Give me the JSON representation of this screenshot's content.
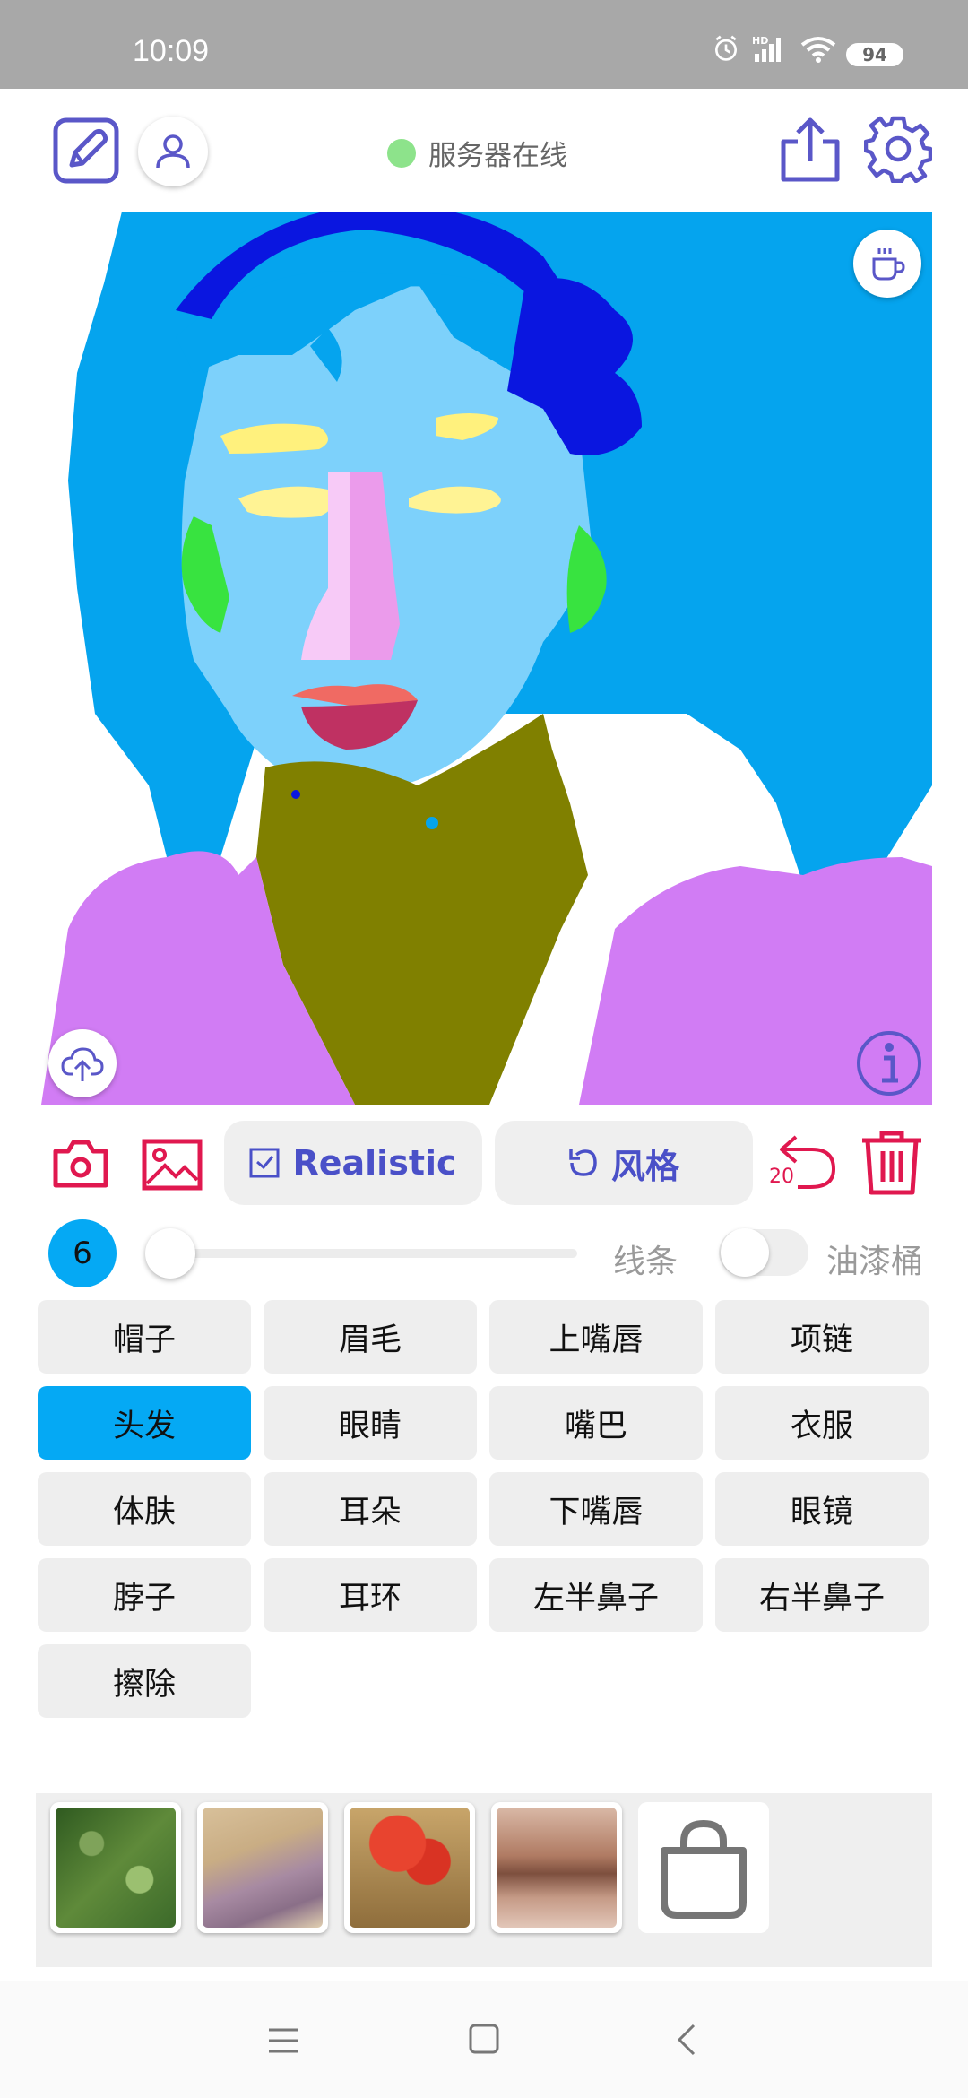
{
  "status_bar": {
    "time": "10:09",
    "battery": "94",
    "icons": [
      "alarm-icon",
      "hd-signal-icon",
      "wifi-icon",
      "battery-icon"
    ]
  },
  "top_bar": {
    "server_status": "服务器在线",
    "server_color": "#8de38b",
    "icons": [
      "edit-icon",
      "user-icon",
      "share-icon",
      "settings-icon"
    ],
    "accent": "#5a57c8"
  },
  "canvas": {
    "icons": [
      "coffee-icon",
      "cloud-upload-icon",
      "info-icon"
    ]
  },
  "toolbar": {
    "realistic_label": "Realistic",
    "style_label": "风格",
    "undo_count": "20",
    "icons": [
      "camera-icon",
      "image-icon",
      "checkbox-icon",
      "refresh-icon",
      "undo-icon",
      "trash-icon"
    ],
    "icon_color": "#e0184f"
  },
  "brush": {
    "size": "6",
    "slider_level": 0,
    "line_label": "线条",
    "bucket_label": "油漆桶",
    "bucket_enabled": false
  },
  "labels": [
    {
      "text": "帽子",
      "active": false
    },
    {
      "text": "眉毛",
      "active": false
    },
    {
      "text": "上嘴唇",
      "active": false
    },
    {
      "text": "项链",
      "active": false
    },
    {
      "text": "头发",
      "active": true
    },
    {
      "text": "眼睛",
      "active": false
    },
    {
      "text": "嘴巴",
      "active": false
    },
    {
      "text": "衣服",
      "active": false
    },
    {
      "text": "体肤",
      "active": false
    },
    {
      "text": "耳朵",
      "active": false
    },
    {
      "text": "下嘴唇",
      "active": false
    },
    {
      "text": "眼镜",
      "active": false
    },
    {
      "text": "脖子",
      "active": false
    },
    {
      "text": "耳环",
      "active": false
    },
    {
      "text": "左半鼻子",
      "active": false
    },
    {
      "text": "右半鼻子",
      "active": false
    },
    {
      "text": "擦除",
      "active": false
    }
  ],
  "active_color": "#05a9f4",
  "styles": {
    "icons": [
      "style-thumbnail-green",
      "style-thumbnail-sketch",
      "style-thumbnail-red",
      "style-thumbnail-blur",
      "shopping-bag-icon"
    ]
  },
  "nav_bar": {
    "icons": [
      "menu-icon",
      "home-icon",
      "back-icon"
    ]
  }
}
